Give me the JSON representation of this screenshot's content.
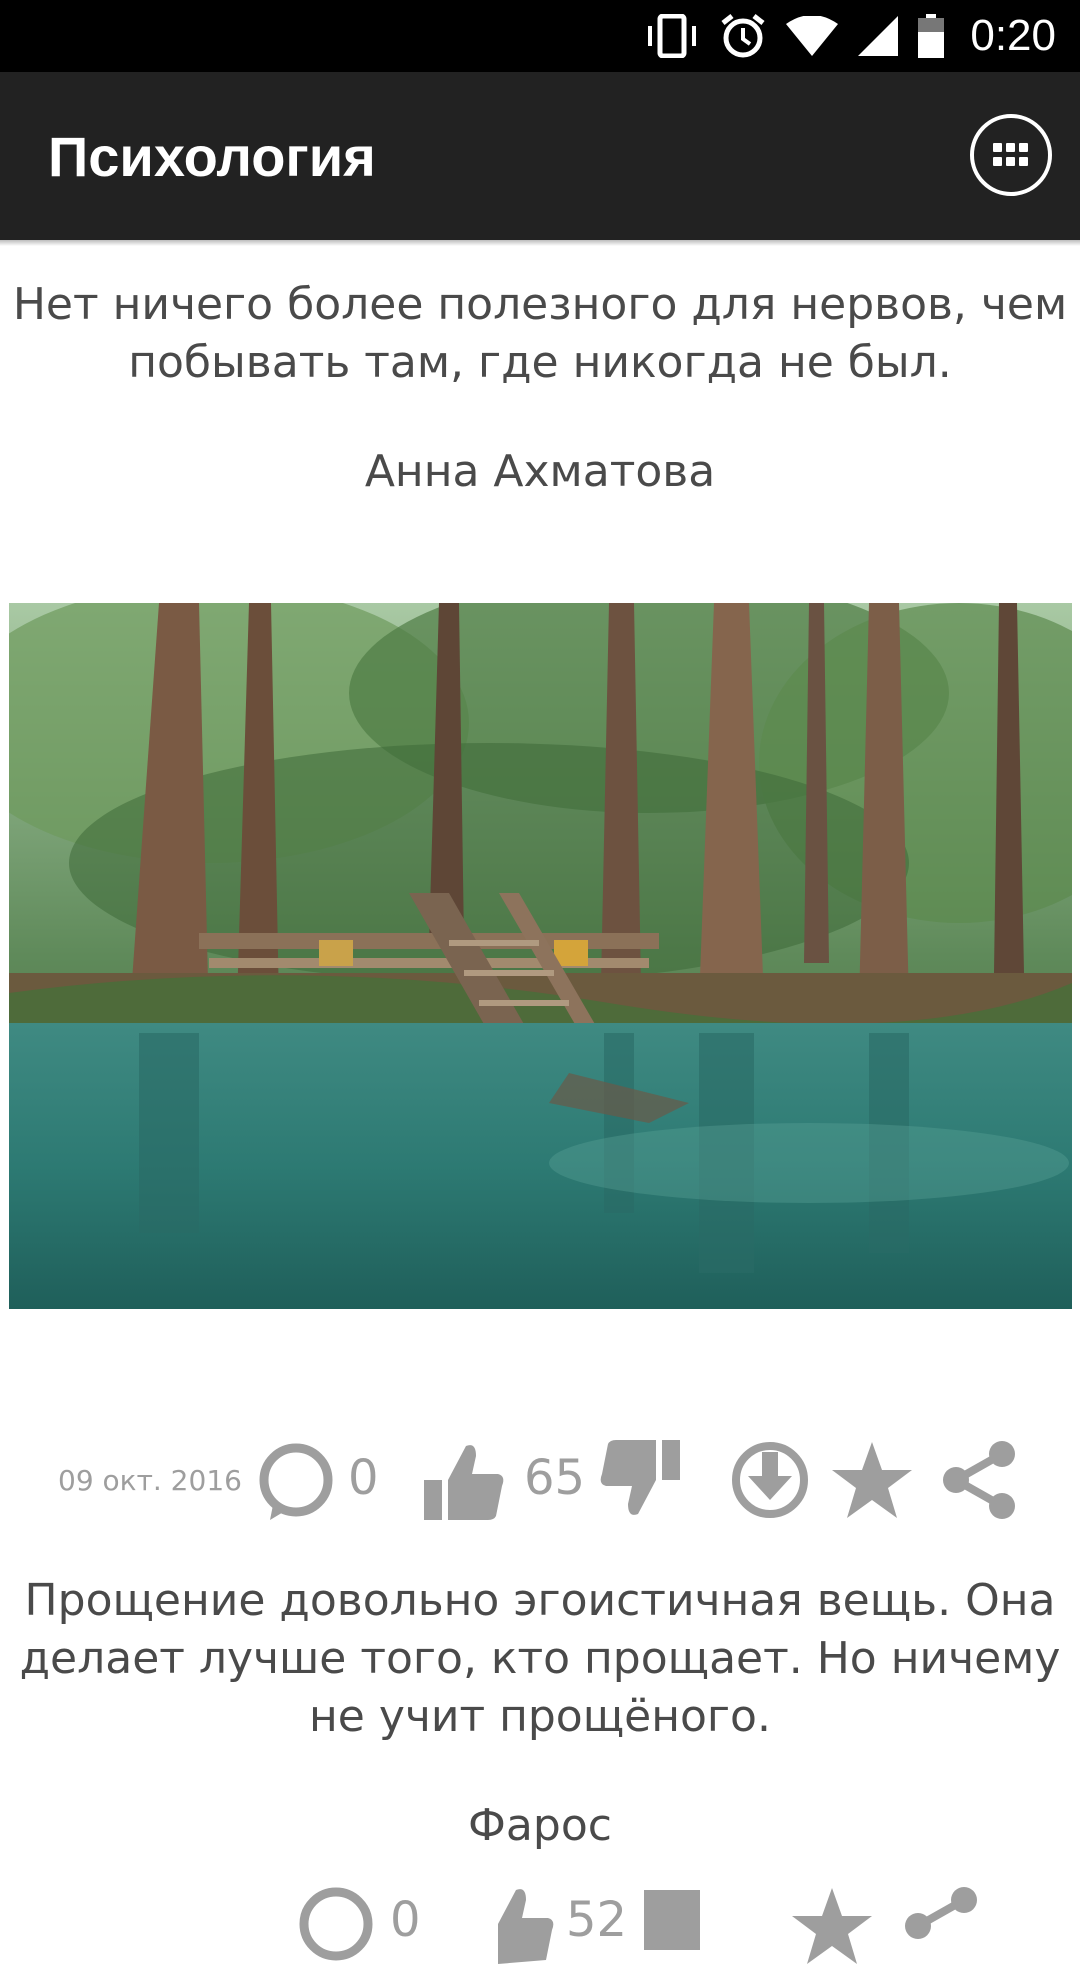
{
  "status_bar": {
    "time": "0:20"
  },
  "app_bar": {
    "title": "Психология"
  },
  "posts": [
    {
      "quote": "Нет ничего более полезного для нервов, чем побывать там, где никогда не был.",
      "author": "Анна Ахматова",
      "date": "09 окт. 2016",
      "comments": "0",
      "likes": "65"
    },
    {
      "quote": "Прощение довольно эгоистичная вещь. Она делает лучше того, кто прощает. Но ничему не учит прощёного.",
      "author": "Фарос",
      "comments": "0",
      "likes": "52"
    }
  ],
  "colors": {
    "status_bar": "#000000",
    "app_bar": "#222222",
    "icon_gray": "#9e9e9e",
    "text": "#4a4a4a"
  }
}
